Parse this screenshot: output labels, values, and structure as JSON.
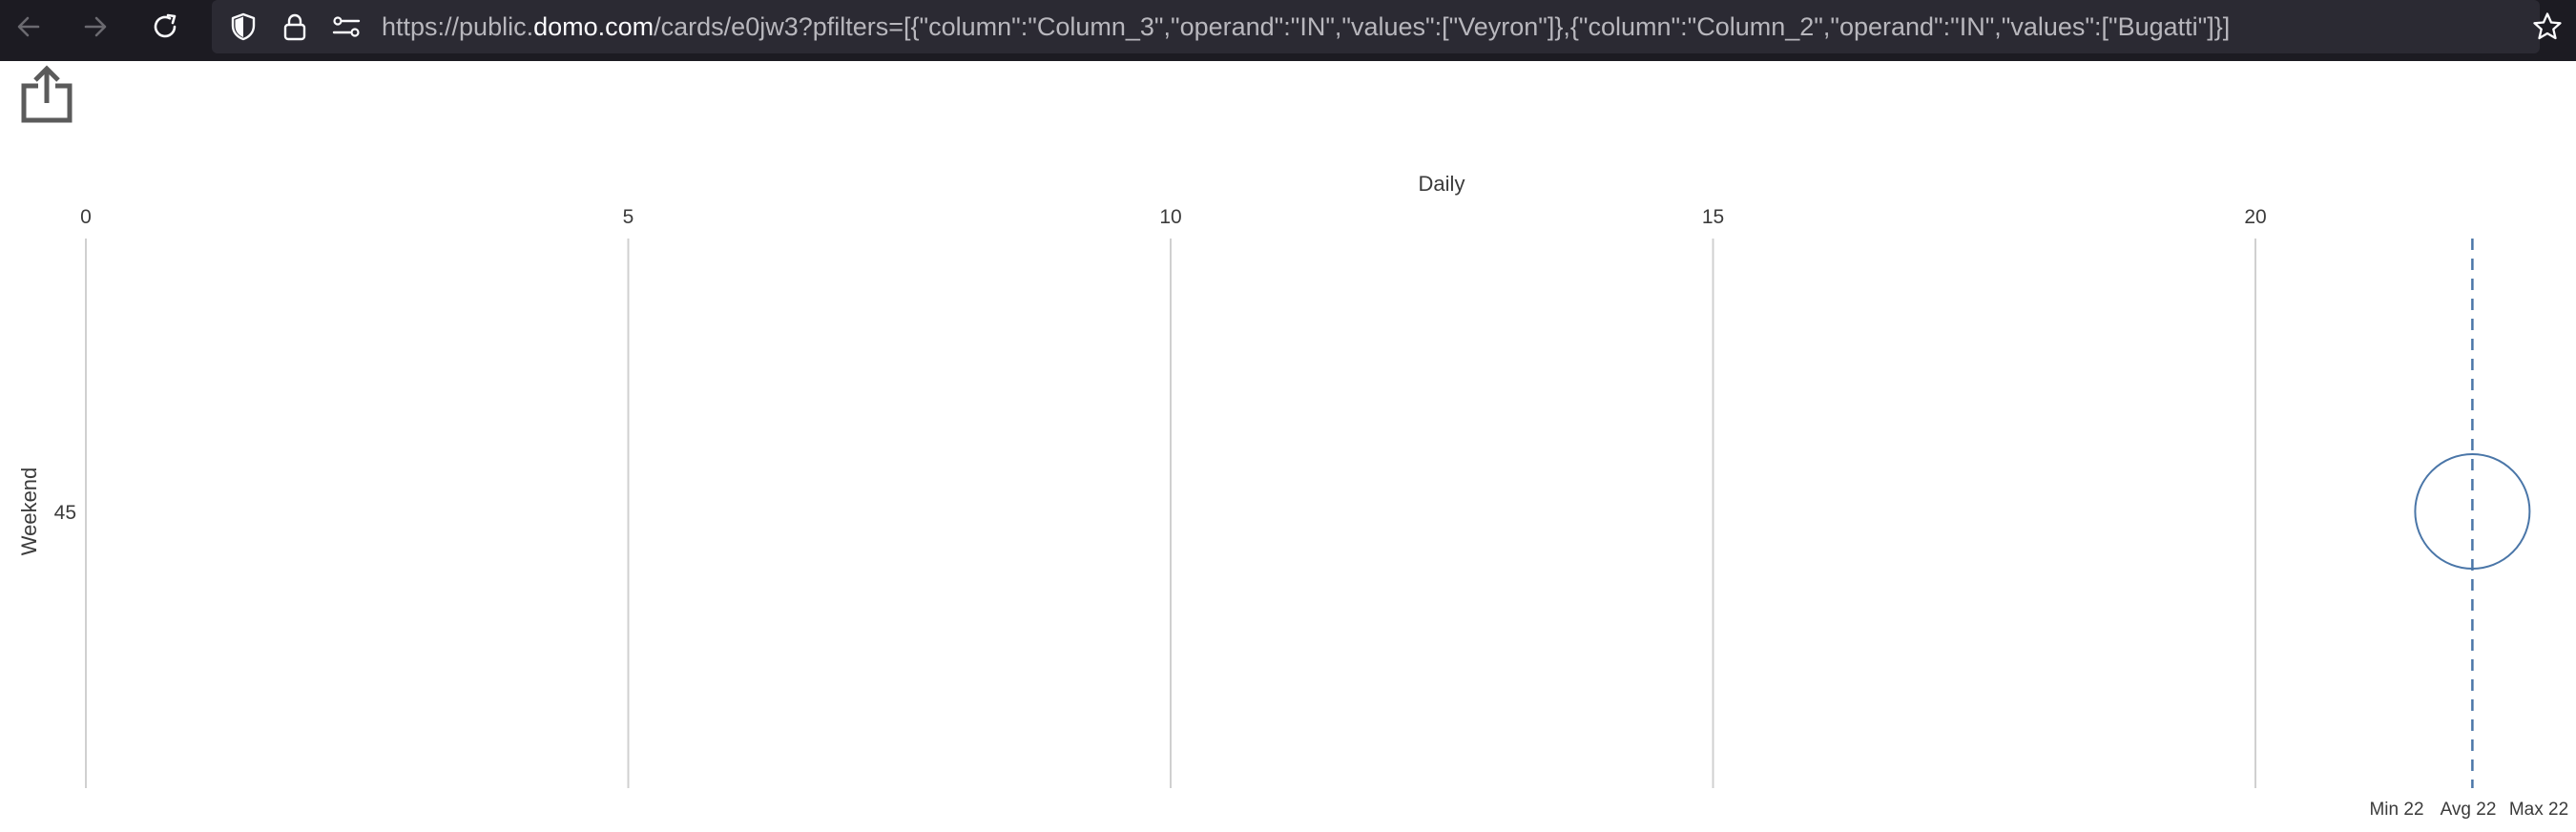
{
  "browser": {
    "url_prefix": "https://public.",
    "url_host": "domo.com",
    "url_rest": "/cards/e0jw3?pfilters=[{\"column\":\"Column_3\",\"operand\":\"IN\",\"values\":[\"Veyron\"]},{\"column\":\"Column_2\",\"operand\":\"IN\",\"values\":[\"Bugatti\"]}]",
    "icons": {
      "back": "arrow-left-icon",
      "forward": "arrow-right-icon",
      "reload": "reload-icon",
      "tracking": "shield-icon",
      "lock": "lock-icon",
      "permissions": "sliders-icon",
      "bookmark": "star-icon",
      "share": "share-icon"
    },
    "colors": {
      "toolbar_bg": "#1c1b22",
      "urlbar_bg": "#2b2a33"
    }
  },
  "chart_data": {
    "type": "scatter",
    "xlabel": "Daily",
    "ylabel": "Weekend",
    "x_ticks": [
      "0",
      "5",
      "10",
      "15",
      "20"
    ],
    "x_tick_values": [
      0,
      5,
      10,
      15,
      20
    ],
    "y_tick_label": "45",
    "xlim": [
      0,
      22
    ],
    "points": [
      {
        "x": 22,
        "y": 45
      }
    ],
    "reference_line": {
      "value": 22,
      "style": "dashed"
    },
    "summary": [
      "Min 22",
      "Avg 22",
      "Max 22"
    ],
    "colors": {
      "point": "#4a76a8",
      "grid": "#d0d0d0"
    }
  }
}
